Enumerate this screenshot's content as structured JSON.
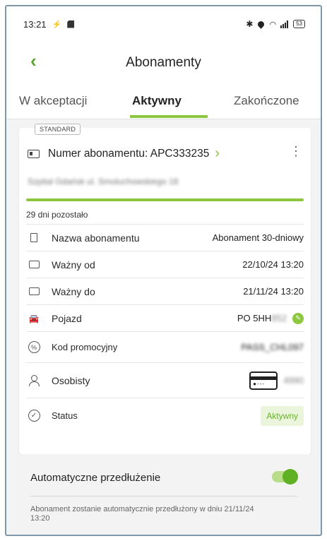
{
  "statusbar": {
    "time": "13:21",
    "battery": "53"
  },
  "header": {
    "title": "Abonamenty"
  },
  "tabs": [
    {
      "label": "W akceptacji",
      "active": false
    },
    {
      "label": "Aktywny",
      "active": true
    },
    {
      "label": "Zakończone",
      "active": false
    }
  ],
  "card": {
    "badge": "STANDARD",
    "number": "Numer abonamentu: APC333235",
    "address": "Szpital Gdańsk ul. Smoluchowskiego 18",
    "progress": 1.0,
    "days_left": "29 dni pozostało",
    "rows": {
      "name": {
        "label": "Nazwa abonamentu",
        "value": "Abonament 30-dniowy"
      },
      "valid_from": {
        "label": "Ważny od",
        "value": "22/10/24 13:20"
      },
      "valid_to": {
        "label": "Ważny do",
        "value": "21/11/24 13:20"
      },
      "vehicle": {
        "label": "Pojazd",
        "value": "PO 5HH",
        "value_hidden": "852"
      },
      "promo": {
        "label": "Kod promocyjny",
        "value_hidden": "PASS_CHL097"
      },
      "personal": {
        "label": "Osobisty",
        "value_hidden": "4990"
      },
      "status": {
        "label": "Status",
        "value": "Aktywny"
      }
    }
  },
  "auto": {
    "label": "Automatyczne przedłużenie",
    "enabled": true,
    "note": "Abonament zostanie automatycznie przedłużony w dniu 21/11/24  13:20"
  },
  "colors": {
    "accent": "#8dc63f",
    "toggle": "#5fb024"
  }
}
